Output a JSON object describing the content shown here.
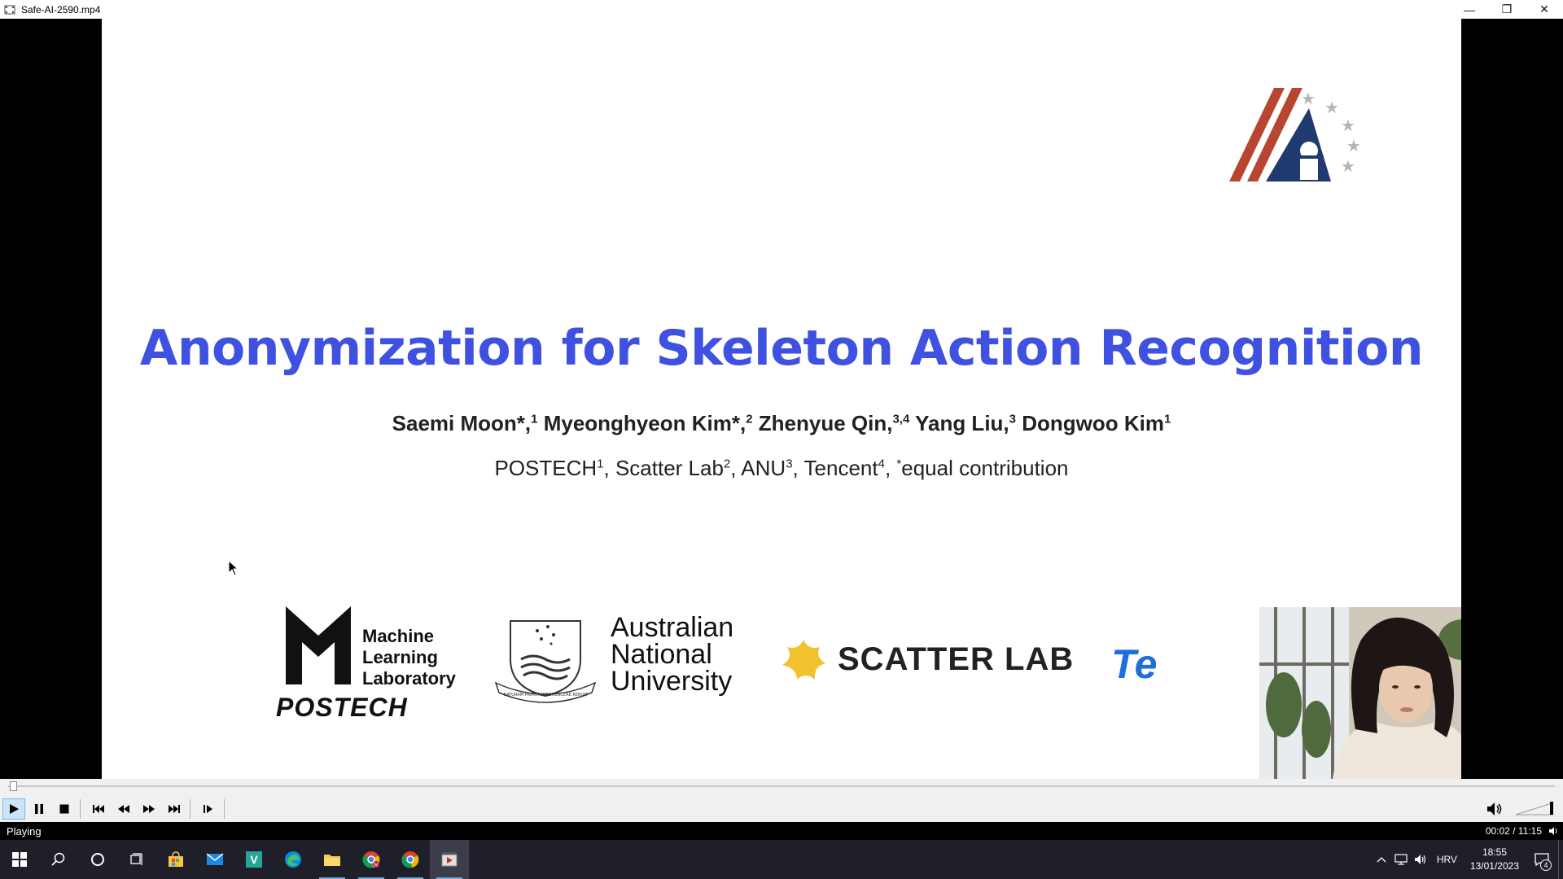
{
  "window": {
    "title": "Safe-AI-2590.mp4",
    "minimize_label": "—",
    "restore_label": "❐",
    "close_label": "✕"
  },
  "slide": {
    "title": "Anonymization for Skeleton Action Recognition",
    "authors": [
      {
        "name": "Saemi Moon*,",
        "sup": "1"
      },
      {
        "name": "Myeonghyeon Kim*,",
        "sup": "2"
      },
      {
        "name": "Zhenyue Qin,",
        "sup": "3,4"
      },
      {
        "name": "Yang Liu,",
        "sup": "3"
      },
      {
        "name": "Dongwoo Kim",
        "sup": "1"
      }
    ],
    "affiliations": [
      {
        "name": "POSTECH",
        "sup": "1"
      },
      {
        "name": "Scatter Lab",
        "sup": "2"
      },
      {
        "name": "ANU",
        "sup": "3"
      },
      {
        "name": "Tencent",
        "sup": "4"
      }
    ],
    "equal_contribution_mark": "*",
    "equal_contribution_text": "equal contribution",
    "logos": {
      "mll_line1": "Machine",
      "mll_line2": "Learning",
      "mll_line3": "Laboratory",
      "postech": "POSTECH",
      "anu_line1": "Australian",
      "anu_line2": "National",
      "anu_line3": "University",
      "anu_motto": "NATURAM PRIMUM COGNOSCERE RERUM",
      "scatter": "SCATTER LAB",
      "tencent_partial": "Te"
    }
  },
  "player": {
    "status": "Playing",
    "time": "00:02 / 11:15",
    "progress_fraction": 0.003
  },
  "taskbar": {
    "language": "HRV",
    "clock_time": "18:55",
    "clock_date": "13/01/2023",
    "notification_count": "4"
  },
  "colors": {
    "title_blue": "#3f51e0",
    "conf_red": "#b8452f",
    "conf_navy": "#1f3a6e",
    "scatter_yellow": "#f2c12e",
    "tencent_blue": "#1e6fd9"
  }
}
